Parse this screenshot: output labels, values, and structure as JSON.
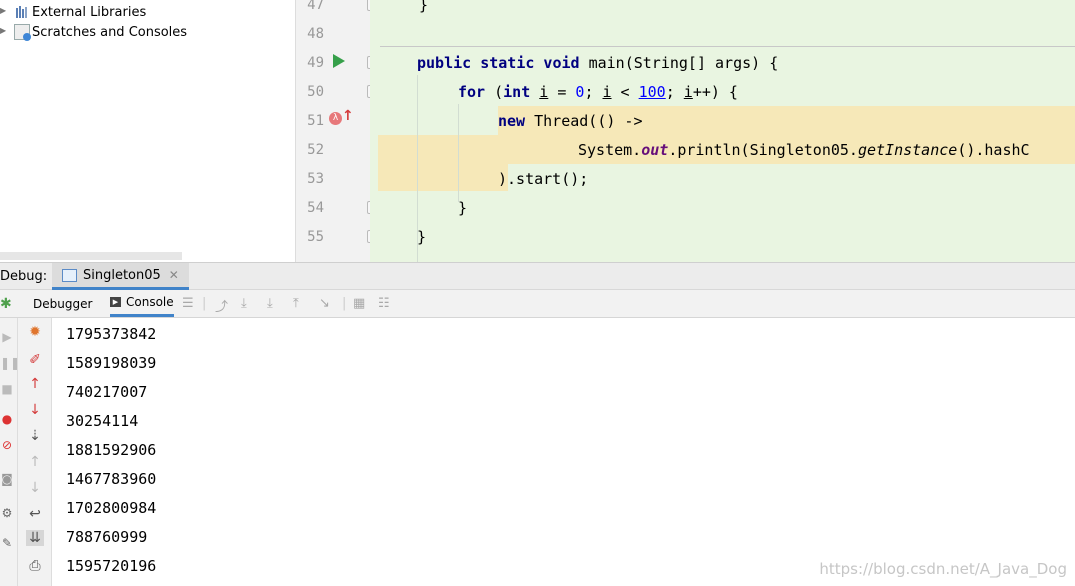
{
  "project": {
    "items": [
      {
        "label": "External Libraries",
        "icon": "library-icon"
      },
      {
        "label": "Scratches and Consoles",
        "icon": "scratches-icon"
      }
    ]
  },
  "editor": {
    "line_numbers": [
      "47",
      "48",
      "49",
      "50",
      "51",
      "52",
      "53",
      "54",
      "55"
    ],
    "code": {
      "l47_brace": "}",
      "l49_kw": "public static void",
      "l49_rest": " main(String[] args) {",
      "l50_for": "for",
      "l50_open": " (",
      "l50_int": "int",
      "l50_sp": " ",
      "l50_i1": "i",
      "l50_eq": " = ",
      "l50_zero": "0",
      "l50_semi1": "; ",
      "l50_i2": "i",
      "l50_lt": " < ",
      "l50_hundred": "100",
      "l50_semi2": "; ",
      "l50_i3": "i",
      "l50_inc": "++) {",
      "l51_new": "new",
      "l51_rest": " Thread(() ->",
      "l52_sys": "System.",
      "l52_out": "out",
      "l52_mid": ".println(Singleton05.",
      "l52_get": "getInstance",
      "l52_end": "().hashC",
      "l53": ").start();",
      "l54": "}",
      "l55": "}"
    },
    "highlight_color": "#f6e8b8",
    "background_color": "#e9f5e1"
  },
  "debug": {
    "label": "Debug:",
    "session_tab": "Singleton05",
    "tabs": {
      "debugger": "Debugger",
      "console": "Console"
    }
  },
  "console": {
    "lines": [
      "1795373842",
      "1589198039",
      "740217007",
      "30254114",
      "1881592906",
      "1467783960",
      "1702800984",
      "788760999",
      "1595720196"
    ]
  },
  "watermark": "https://blog.csdn.net/A_Java_Dog"
}
